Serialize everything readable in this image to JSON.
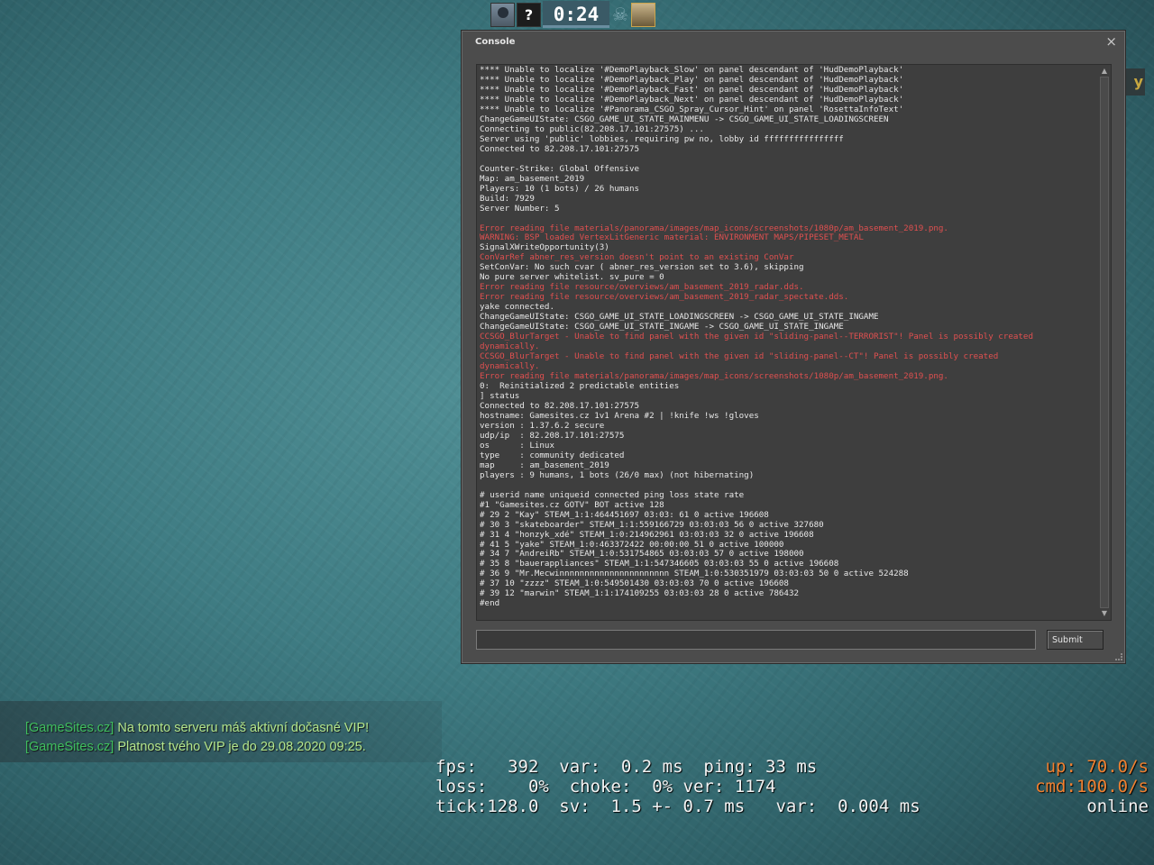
{
  "hud": {
    "timer": "0:24",
    "avatar2_text": "?"
  },
  "console": {
    "title": "Console",
    "close_glyph": "×",
    "submit_label": "Submit",
    "input_value": "",
    "lines": [
      {
        "t": "**** Unable to localize '#DemoPlayback_Slow' on panel descendant of 'HudDemoPlayback'",
        "e": false
      },
      {
        "t": "**** Unable to localize '#DemoPlayback_Play' on panel descendant of 'HudDemoPlayback'",
        "e": false
      },
      {
        "t": "**** Unable to localize '#DemoPlayback_Fast' on panel descendant of 'HudDemoPlayback'",
        "e": false
      },
      {
        "t": "**** Unable to localize '#DemoPlayback_Next' on panel descendant of 'HudDemoPlayback'",
        "e": false
      },
      {
        "t": "**** Unable to localize '#Panorama_CSGO_Spray_Cursor_Hint' on panel 'RosettaInfoText'",
        "e": false
      },
      {
        "t": "ChangeGameUIState: CSGO_GAME_UI_STATE_MAINMENU -> CSGO_GAME_UI_STATE_LOADINGSCREEN",
        "e": false
      },
      {
        "t": "Connecting to public(82.208.17.101:27575) ...",
        "e": false
      },
      {
        "t": "Server using 'public' lobbies, requiring pw no, lobby id ffffffffffffffff",
        "e": false
      },
      {
        "t": "Connected to 82.208.17.101:27575",
        "e": false
      },
      {
        "t": "",
        "e": false
      },
      {
        "t": "Counter-Strike: Global Offensive",
        "e": false
      },
      {
        "t": "Map: am_basement_2019",
        "e": false
      },
      {
        "t": "Players: 10 (1 bots) / 26 humans",
        "e": false
      },
      {
        "t": "Build: 7929",
        "e": false
      },
      {
        "t": "Server Number: 5",
        "e": false
      },
      {
        "t": "",
        "e": false
      },
      {
        "t": "Error reading file materials/panorama/images/map_icons/screenshots/1080p/am_basement_2019.png.",
        "e": true
      },
      {
        "t": "WARNING: BSP loaded VertexLitGeneric material: ENVIRONMENT MAPS/PIPESET_METAL",
        "e": true
      },
      {
        "t": "SignalXWriteOpportunity(3)",
        "e": false
      },
      {
        "t": "ConVarRef abner_res_version doesn't point to an existing ConVar",
        "e": true
      },
      {
        "t": "SetConVar: No such cvar ( abner_res_version set to 3.6), skipping",
        "e": false
      },
      {
        "t": "No pure server whitelist. sv_pure = 0",
        "e": false
      },
      {
        "t": "Error reading file resource/overviews/am_basement_2019_radar.dds.",
        "e": true
      },
      {
        "t": "Error reading file resource/overviews/am_basement_2019_radar_spectate.dds.",
        "e": true
      },
      {
        "t": "yake connected.",
        "e": false
      },
      {
        "t": "ChangeGameUIState: CSGO_GAME_UI_STATE_LOADINGSCREEN -> CSGO_GAME_UI_STATE_INGAME",
        "e": false
      },
      {
        "t": "ChangeGameUIState: CSGO_GAME_UI_STATE_INGAME -> CSGO_GAME_UI_STATE_INGAME",
        "e": false
      },
      {
        "t": "CCSGO_BlurTarget - Unable to find panel with the given id \"sliding-panel--TERRORIST\"! Panel is possibly created",
        "e": true
      },
      {
        "t": "dynamically.",
        "e": true
      },
      {
        "t": "CCSGO_BlurTarget - Unable to find panel with the given id \"sliding-panel--CT\"! Panel is possibly created",
        "e": true
      },
      {
        "t": "dynamically.",
        "e": true
      },
      {
        "t": "Error reading file materials/panorama/images/map_icons/screenshots/1080p/am_basement_2019.png.",
        "e": true
      },
      {
        "t": "0:  Reinitialized 2 predictable entities",
        "e": false
      },
      {
        "t": "] status",
        "e": false
      },
      {
        "t": "Connected to 82.208.17.101:27575",
        "e": false
      },
      {
        "t": "hostname: Gamesites.cz 1v1 Arena #2 | !knife !ws !gloves",
        "e": false
      },
      {
        "t": "version : 1.37.6.2 secure",
        "e": false
      },
      {
        "t": "udp/ip  : 82.208.17.101:27575",
        "e": false
      },
      {
        "t": "os      : Linux",
        "e": false
      },
      {
        "t": "type    : community dedicated",
        "e": false
      },
      {
        "t": "map     : am_basement_2019",
        "e": false
      },
      {
        "t": "players : 9 humans, 1 bots (26/0 max) (not hibernating)",
        "e": false
      },
      {
        "t": "",
        "e": false
      },
      {
        "t": "# userid name uniqueid connected ping loss state rate",
        "e": false
      },
      {
        "t": "#1 \"Gamesites.cz GOTV\" BOT active 128",
        "e": false
      },
      {
        "t": "# 29 2 \"Kay\" STEAM_1:1:464451697 03:03: 61 0 active 196608",
        "e": false
      },
      {
        "t": "# 30 3 \"skateboarder\" STEAM_1:1:559166729 03:03:03 56 0 active 327680",
        "e": false
      },
      {
        "t": "# 31 4 \"honzyk_xdé\" STEAM_1:0:214962961 03:03:03 32 0 active 196608",
        "e": false
      },
      {
        "t": "# 41 5 \"yake\" STEAM_1:0:463372422 00:00:00 51 0 active 100000",
        "e": false
      },
      {
        "t": "# 34 7 \"AndreiRb\" STEAM_1:0:531754865 03:03:03 57 0 active 198000",
        "e": false
      },
      {
        "t": "# 35 8 \"bauerappliances\" STEAM_1:1:547346605 03:03:03 55 0 active 196608",
        "e": false
      },
      {
        "t": "# 36 9 \"Mr.Mecwinnnnnnnnnnnnnnnnnnnnnn STEAM_1:0:530351979 03:03:03 50 0 active 524288",
        "e": false
      },
      {
        "t": "# 37 10 \"zzzz\" STEAM_1:0:549501430 03:03:03 70 0 active 196608",
        "e": false
      },
      {
        "t": "# 39 12 \"marwin\" STEAM_1:1:174109255 03:03:03 28 0 active 786432",
        "e": false
      },
      {
        "t": "#end",
        "e": false
      }
    ]
  },
  "edge_fragment": "y",
  "chat": {
    "line1": {
      "tag": "[GameSites.cz]",
      "msg": " Na tomto serveru máš aktivní dočasné VIP!"
    },
    "line2": {
      "tag": "[GameSites.cz]",
      "msg": " Platnost tvého VIP je do 29.08.2020 09:25."
    }
  },
  "netgraph": {
    "row1": "fps:   392  var:  0.2 ms  ping: 33 ms",
    "row2": "loss:    0%  choke:  0% ver: 1174",
    "row3": "tick:128.0  sv:  1.5 +- 0.7 ms   var:  0.004 ms",
    "up": "up: 70.0/s",
    "cmd": "cmd:100.0/s",
    "status": "online"
  },
  "colors": {
    "error_text": "#e05050",
    "chat_tag": "#3fbf5f",
    "chat_msg": "#b3e68c",
    "netgraph_rate": "#f08030"
  }
}
